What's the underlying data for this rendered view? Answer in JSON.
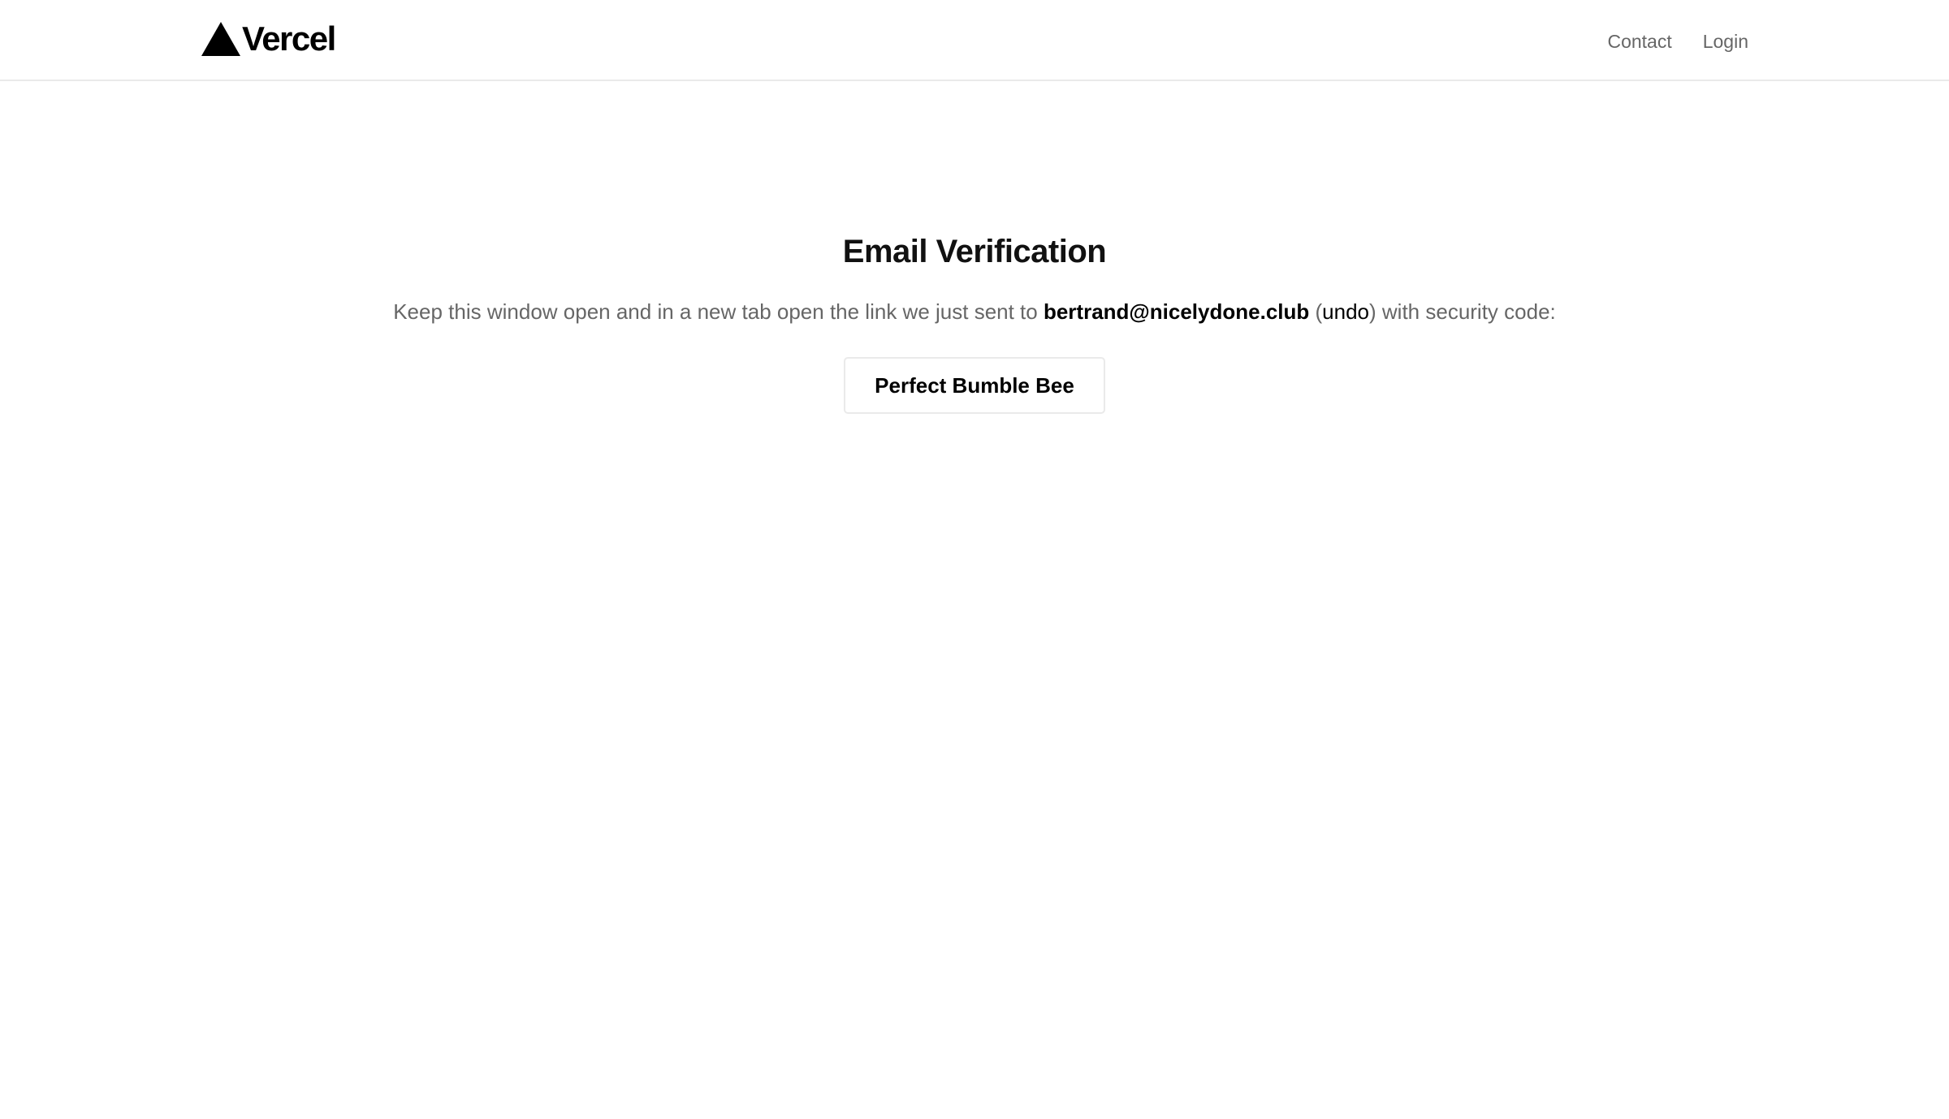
{
  "header": {
    "logo_text": "Vercel",
    "logo_icon": "triangle-logo-icon",
    "nav": {
      "contact_label": "Contact",
      "login_label": "Login"
    }
  },
  "main": {
    "title": "Email Verification",
    "message_before": "Keep this window open and in a new tab open the link we just sent to ",
    "email": "bertrand@nicelydone.club",
    "paren_open": " (",
    "undo_label": "undo",
    "paren_close_after": ") with security code:",
    "security_code": "Perfect Bumble Bee"
  },
  "colors": {
    "text_primary": "#111111",
    "text_secondary": "#666666",
    "border": "#eaeaea",
    "background": "#ffffff"
  }
}
